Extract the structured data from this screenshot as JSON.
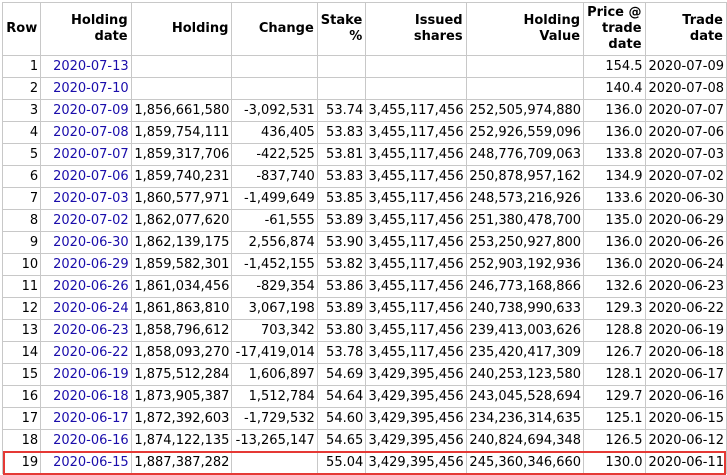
{
  "headers": {
    "row": "Row",
    "holding_date": [
      "Holding",
      "date"
    ],
    "holding": "Holding",
    "change": "Change",
    "stake": [
      "Stake",
      "%"
    ],
    "issued": [
      "Issued",
      "shares"
    ],
    "value": [
      "Holding",
      "Value"
    ],
    "price": [
      "Price @",
      "trade",
      "date"
    ],
    "trade_date": [
      "Trade",
      "date"
    ]
  },
  "rows": [
    {
      "row": "1",
      "holding_date": "2020-07-13",
      "holding": "",
      "change": "",
      "stake": "",
      "issued": "",
      "value": "",
      "price": "154.5",
      "trade_date": "2020-07-09"
    },
    {
      "row": "2",
      "holding_date": "2020-07-10",
      "holding": "",
      "change": "",
      "stake": "",
      "issued": "",
      "value": "",
      "price": "140.4",
      "trade_date": "2020-07-08"
    },
    {
      "row": "3",
      "holding_date": "2020-07-09",
      "holding": "1,856,661,580",
      "change": "-3,092,531",
      "stake": "53.74",
      "issued": "3,455,117,456",
      "value": "252,505,974,880",
      "price": "136.0",
      "trade_date": "2020-07-07"
    },
    {
      "row": "4",
      "holding_date": "2020-07-08",
      "holding": "1,859,754,111",
      "change": "436,405",
      "stake": "53.83",
      "issued": "3,455,117,456",
      "value": "252,926,559,096",
      "price": "136.0",
      "trade_date": "2020-07-06"
    },
    {
      "row": "5",
      "holding_date": "2020-07-07",
      "holding": "1,859,317,706",
      "change": "-422,525",
      "stake": "53.81",
      "issued": "3,455,117,456",
      "value": "248,776,709,063",
      "price": "133.8",
      "trade_date": "2020-07-03"
    },
    {
      "row": "6",
      "holding_date": "2020-07-06",
      "holding": "1,859,740,231",
      "change": "-837,740",
      "stake": "53.83",
      "issued": "3,455,117,456",
      "value": "250,878,957,162",
      "price": "134.9",
      "trade_date": "2020-07-02"
    },
    {
      "row": "7",
      "holding_date": "2020-07-03",
      "holding": "1,860,577,971",
      "change": "-1,499,649",
      "stake": "53.85",
      "issued": "3,455,117,456",
      "value": "248,573,216,926",
      "price": "133.6",
      "trade_date": "2020-06-30"
    },
    {
      "row": "8",
      "holding_date": "2020-07-02",
      "holding": "1,862,077,620",
      "change": "-61,555",
      "stake": "53.89",
      "issued": "3,455,117,456",
      "value": "251,380,478,700",
      "price": "135.0",
      "trade_date": "2020-06-29"
    },
    {
      "row": "9",
      "holding_date": "2020-06-30",
      "holding": "1,862,139,175",
      "change": "2,556,874",
      "stake": "53.90",
      "issued": "3,455,117,456",
      "value": "253,250,927,800",
      "price": "136.0",
      "trade_date": "2020-06-26"
    },
    {
      "row": "10",
      "holding_date": "2020-06-29",
      "holding": "1,859,582,301",
      "change": "-1,452,155",
      "stake": "53.82",
      "issued": "3,455,117,456",
      "value": "252,903,192,936",
      "price": "136.0",
      "trade_date": "2020-06-24"
    },
    {
      "row": "11",
      "holding_date": "2020-06-26",
      "holding": "1,861,034,456",
      "change": "-829,354",
      "stake": "53.86",
      "issued": "3,455,117,456",
      "value": "246,773,168,866",
      "price": "132.6",
      "trade_date": "2020-06-23"
    },
    {
      "row": "12",
      "holding_date": "2020-06-24",
      "holding": "1,861,863,810",
      "change": "3,067,198",
      "stake": "53.89",
      "issued": "3,455,117,456",
      "value": "240,738,990,633",
      "price": "129.3",
      "trade_date": "2020-06-22"
    },
    {
      "row": "13",
      "holding_date": "2020-06-23",
      "holding": "1,858,796,612",
      "change": "703,342",
      "stake": "53.80",
      "issued": "3,455,117,456",
      "value": "239,413,003,626",
      "price": "128.8",
      "trade_date": "2020-06-19"
    },
    {
      "row": "14",
      "holding_date": "2020-06-22",
      "holding": "1,858,093,270",
      "change": "-17,419,014",
      "stake": "53.78",
      "issued": "3,455,117,456",
      "value": "235,420,417,309",
      "price": "126.7",
      "trade_date": "2020-06-18"
    },
    {
      "row": "15",
      "holding_date": "2020-06-19",
      "holding": "1,875,512,284",
      "change": "1,606,897",
      "stake": "54.69",
      "issued": "3,429,395,456",
      "value": "240,253,123,580",
      "price": "128.1",
      "trade_date": "2020-06-17"
    },
    {
      "row": "16",
      "holding_date": "2020-06-18",
      "holding": "1,873,905,387",
      "change": "1,512,784",
      "stake": "54.64",
      "issued": "3,429,395,456",
      "value": "243,045,528,694",
      "price": "129.7",
      "trade_date": "2020-06-16"
    },
    {
      "row": "17",
      "holding_date": "2020-06-17",
      "holding": "1,872,392,603",
      "change": "-1,729,532",
      "stake": "54.60",
      "issued": "3,429,395,456",
      "value": "234,236,314,635",
      "price": "125.1",
      "trade_date": "2020-06-15"
    },
    {
      "row": "18",
      "holding_date": "2020-06-16",
      "holding": "1,874,122,135",
      "change": "-13,265,147",
      "stake": "54.65",
      "issued": "3,429,395,456",
      "value": "240,824,694,348",
      "price": "126.5",
      "trade_date": "2020-06-12"
    },
    {
      "row": "19",
      "holding_date": "2020-06-15",
      "holding": "1,887,387,282",
      "change": "",
      "stake": "55.04",
      "issued": "3,429,395,456",
      "value": "245,360,346,660",
      "price": "130.0",
      "trade_date": "2020-06-11"
    }
  ],
  "highlight_color": "#e53935",
  "link_color": "#1a0dab"
}
